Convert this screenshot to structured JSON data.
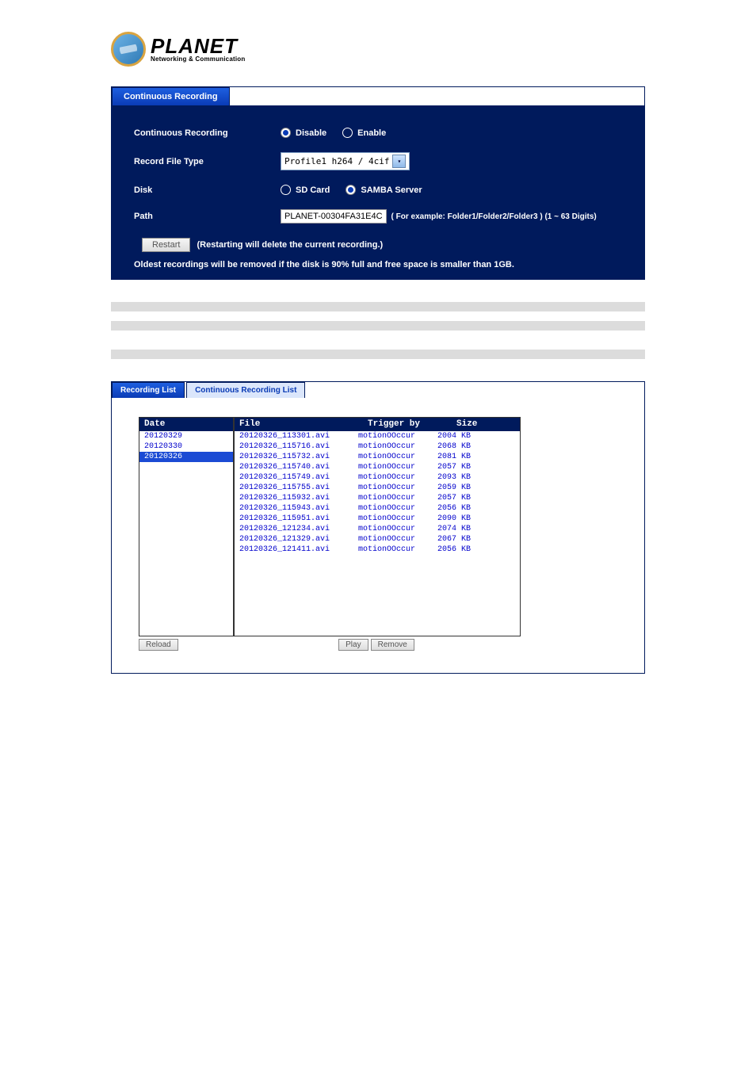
{
  "logo": {
    "main": "PLANET",
    "sub": "Networking & Communication"
  },
  "cr_panel": {
    "tab": "Continuous Recording",
    "rows": {
      "cr_label": "Continuous Recording",
      "cr_disable": "Disable",
      "cr_enable": "Enable",
      "rft_label": "Record File Type",
      "rft_value": "Profile1 h264 / 4cif",
      "disk_label": "Disk",
      "disk_sd": "SD Card",
      "disk_samba": "SAMBA Server",
      "path_label": "Path",
      "path_value": "PLANET-00304FA31E4C",
      "path_hint": "( For example: Folder1/Folder2/Folder3 ) (1 ~ 63 Digits)",
      "restart_btn": "Restart",
      "restart_note": "(Restarting will delete the current recording.)",
      "warning": "Oldest recordings will be removed if the disk is 90% full and free space is smaller than 1GB."
    }
  },
  "defs": [
    {
      "term": "",
      "desc": ""
    },
    {
      "term": "",
      "desc": ""
    },
    {
      "term": "",
      "desc": ""
    },
    {
      "term": "",
      "desc": ""
    },
    {
      "term": "",
      "desc": ""
    },
    {
      "term": "",
      "desc": ""
    }
  ],
  "rec_list": {
    "section_title": "",
    "intro": "",
    "tab_active": "Recording List",
    "tab_inactive": "Continuous Recording List",
    "date_header": "Date",
    "file_header": "File",
    "trig_header": "Trigger by",
    "size_header": "Size",
    "dates": [
      {
        "d": "20120329",
        "sel": false
      },
      {
        "d": "20120330",
        "sel": false
      },
      {
        "d": "20120326",
        "sel": true
      }
    ],
    "files": [
      {
        "f": "20120326_113301.avi",
        "t": "motionOOccur",
        "s": "2004 KB"
      },
      {
        "f": "20120326_115716.avi",
        "t": "motionOOccur",
        "s": "2068 KB"
      },
      {
        "f": "20120326_115732.avi",
        "t": "motionOOccur",
        "s": "2081 KB"
      },
      {
        "f": "20120326_115740.avi",
        "t": "motionOOccur",
        "s": "2057 KB"
      },
      {
        "f": "20120326_115749.avi",
        "t": "motionOOccur",
        "s": "2093 KB"
      },
      {
        "f": "20120326_115755.avi",
        "t": "motionOOccur",
        "s": "2059 KB"
      },
      {
        "f": "20120326_115932.avi",
        "t": "motionOOccur",
        "s": "2057 KB"
      },
      {
        "f": "20120326_115943.avi",
        "t": "motionOOccur",
        "s": "2056 KB"
      },
      {
        "f": "20120326_115951.avi",
        "t": "motionOOccur",
        "s": "2090 KB"
      },
      {
        "f": "20120326_121234.avi",
        "t": "motionOOccur",
        "s": "2074 KB"
      },
      {
        "f": "20120326_121329.avi",
        "t": "motionOOccur",
        "s": "2067 KB"
      },
      {
        "f": "20120326_121411.avi",
        "t": "motionOOccur",
        "s": "2056 KB"
      }
    ],
    "reload_btn": "Reload",
    "play_btn": "Play",
    "remove_btn": "Remove"
  }
}
